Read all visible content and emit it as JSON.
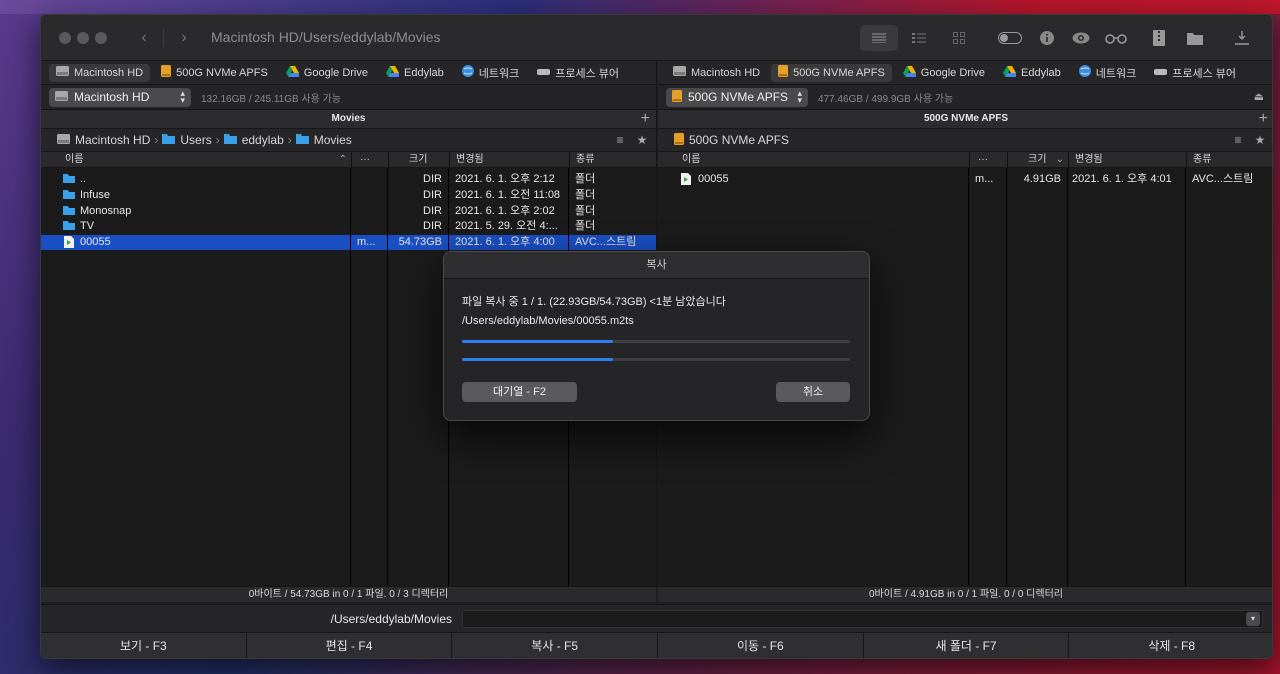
{
  "window": {
    "title": "Macintosh HD/Users/eddylab/Movies"
  },
  "favorites_left": [
    {
      "label": "Macintosh HD",
      "icon": "hdd-icon"
    },
    {
      "label": "500G NVMe APFS",
      "icon": "drive-icon"
    },
    {
      "label": "Google Drive",
      "icon": "google-drive-icon"
    },
    {
      "label": "Eddylab",
      "icon": "google-drive-icon"
    },
    {
      "label": "네트워크",
      "icon": "network-icon"
    },
    {
      "label": "프로세스 뷰어",
      "icon": "process-viewer-icon"
    }
  ],
  "favorites_right": [
    {
      "label": "Macintosh HD",
      "icon": "hdd-icon"
    },
    {
      "label": "500G NVMe APFS",
      "icon": "drive-icon"
    },
    {
      "label": "Google Drive",
      "icon": "google-drive-icon"
    },
    {
      "label": "Eddylab",
      "icon": "google-drive-icon"
    },
    {
      "label": "네트워크",
      "icon": "network-icon"
    },
    {
      "label": "프로세스 뷰어",
      "icon": "process-viewer-icon"
    }
  ],
  "left": {
    "volume": "Macintosh HD",
    "volume_info": "132.16GB / 245.11GB 사용 가능",
    "path_title": "Movies",
    "breadcrumbs": [
      "Macintosh HD",
      "Users",
      "eddylab",
      "Movies"
    ],
    "columns": [
      "이름",
      "···",
      "크기",
      "변경됨",
      "종류"
    ],
    "rows": [
      {
        "name": "..",
        "ext": "",
        "size": "DIR",
        "modified": "2021. 6. 1. 오후 2:12",
        "kind": "폴더",
        "type": "folder"
      },
      {
        "name": "Infuse",
        "ext": "",
        "size": "DIR",
        "modified": "2021. 6. 1. 오전 11:08",
        "kind": "폴더",
        "type": "folder"
      },
      {
        "name": "Monosnap",
        "ext": "",
        "size": "DIR",
        "modified": "2021. 6. 1. 오후 2:02",
        "kind": "폴더",
        "type": "folder"
      },
      {
        "name": "TV",
        "ext": "",
        "size": "DIR",
        "modified": "2021. 5. 29. 오전 4:...",
        "kind": "폴더",
        "type": "folder"
      },
      {
        "name": "00055",
        "ext": "m...",
        "size": "54.73GB",
        "modified": "2021. 6. 1. 오후 4:00",
        "kind": "AVC...스트림",
        "type": "file"
      }
    ],
    "status": "0바이트 / 54.73GB in 0 / 1 파일. 0 / 3 디렉터리"
  },
  "right": {
    "volume": "500G NVMe APFS",
    "volume_info": "477.46GB / 499.9GB 사용 가능",
    "path_title": "500G NVMe APFS",
    "breadcrumbs": [
      "500G NVMe APFS"
    ],
    "columns": [
      "이름",
      "···",
      "크기",
      "변경됨",
      "종류"
    ],
    "rows": [
      {
        "name": "00055",
        "ext": "m...",
        "size": "4.91GB",
        "modified": "2021. 6. 1. 오후 4:01",
        "kind": "AVC...스트림",
        "type": "file"
      }
    ],
    "status": "0바이트 / 4.91GB in 0 / 1 파일. 0 / 0 디렉터리"
  },
  "command_bar": {
    "path": "/Users/eddylab/Movies"
  },
  "function_keys": [
    "보기 - F3",
    "편집 - F4",
    "복사 - F5",
    "이동 - F6",
    "새 폴더 - F7",
    "삭제 - F8"
  ],
  "copy_dialog": {
    "title": "복사",
    "message": "파일 복사 중 1 / 1. (22.93GB/54.73GB) <1분 남았습니다",
    "file_path": "/Users/eddylab/Movies/00055.m2ts",
    "file_progress": 0.39,
    "total_progress": 0.39,
    "queue_button": "대기열 - F2",
    "cancel_button": "취소"
  },
  "colors": {
    "selection": "#1a4fc4",
    "progress": "#2f7cf0",
    "folder": "#3aa0e8"
  }
}
